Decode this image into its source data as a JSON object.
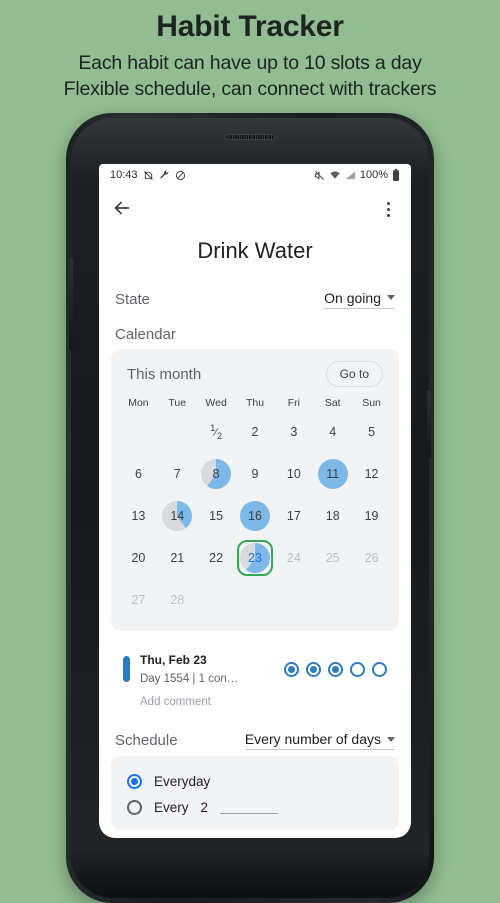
{
  "promo": {
    "title": "Habit Tracker",
    "subtitle_line1": "Each habit can have up to 10 slots a day",
    "subtitle_line2": "Flexible schedule, can connect with trackers"
  },
  "colors": {
    "background_green": "#92bd92",
    "accent_blue": "#7cb9e8",
    "slot_blue": "#2e7bbe",
    "radio_blue": "#1a73e8",
    "selected_ring_green": "#34a853",
    "card_grey": "#f1f3f4",
    "empty_day_grey": "#d8dadd"
  },
  "status_bar": {
    "time": "10:43",
    "left_icons": [
      "no-sim-icon",
      "wrench-icon",
      "do-not-disturb-icon"
    ],
    "right_icons": [
      "mute-icon",
      "wifi-icon",
      "signal-icon"
    ],
    "battery": "100%",
    "battery_icon": "battery-full-icon"
  },
  "app_bar": {
    "back_icon": "back-arrow-icon",
    "overflow_icon": "more-vertical-icon"
  },
  "habit": {
    "title": "Drink Water"
  },
  "state_row": {
    "label": "State",
    "value": "On going",
    "caret_icon": "chevron-down-icon"
  },
  "calendar": {
    "section_label": "Calendar",
    "month_label": "This month",
    "goto_label": "Go to",
    "weekdays": [
      "Mon",
      "Tue",
      "Wed",
      "Thu",
      "Fri",
      "Sat",
      "Sun"
    ],
    "weeks": [
      [
        {
          "label": "",
          "blank": true
        },
        {
          "label": "",
          "blank": true
        },
        {
          "label": "1/2",
          "fraction": true,
          "numerator": "1",
          "denominator": "2",
          "fill": 0,
          "dim": false
        },
        {
          "label": "2",
          "fill": 0,
          "dim": false
        },
        {
          "label": "3",
          "fill": 0,
          "dim": false
        },
        {
          "label": "4",
          "fill": 0,
          "dim": false
        },
        {
          "label": "5",
          "fill": 0,
          "dim": false
        }
      ],
      [
        {
          "label": "6",
          "fill": 0,
          "dim": false
        },
        {
          "label": "7",
          "fill": 0,
          "dim": false
        },
        {
          "label": "8",
          "fill": 60,
          "dim": false
        },
        {
          "label": "9",
          "fill": 0,
          "dim": false
        },
        {
          "label": "10",
          "fill": 0,
          "dim": false
        },
        {
          "label": "11",
          "fill": 100,
          "dim": false
        },
        {
          "label": "12",
          "fill": 0,
          "dim": false
        }
      ],
      [
        {
          "label": "13",
          "fill": 0,
          "dim": false
        },
        {
          "label": "14",
          "fill": 40,
          "dim": false
        },
        {
          "label": "15",
          "fill": 0,
          "dim": false
        },
        {
          "label": "16",
          "fill": 100,
          "dim": false
        },
        {
          "label": "17",
          "fill": 0,
          "dim": false
        },
        {
          "label": "18",
          "fill": 0,
          "dim": false
        },
        {
          "label": "19",
          "fill": 0,
          "dim": false
        }
      ],
      [
        {
          "label": "20",
          "fill": 0,
          "dim": false
        },
        {
          "label": "21",
          "fill": 0,
          "dim": false
        },
        {
          "label": "22",
          "fill": 0,
          "dim": false
        },
        {
          "label": "23",
          "fill": 60,
          "dim": false,
          "selected": true
        },
        {
          "label": "24",
          "fill": 0,
          "dim": true
        },
        {
          "label": "25",
          "fill": 0,
          "dim": true
        },
        {
          "label": "26",
          "fill": 0,
          "dim": true
        }
      ],
      [
        {
          "label": "27",
          "fill": 0,
          "dim": true
        },
        {
          "label": "28",
          "fill": 0,
          "dim": true
        },
        {
          "label": "",
          "blank": true
        },
        {
          "label": "",
          "blank": true
        },
        {
          "label": "",
          "blank": true
        },
        {
          "label": "",
          "blank": true
        },
        {
          "label": "",
          "blank": true
        }
      ]
    ]
  },
  "entry": {
    "date": "Thu, Feb 23",
    "meta": "Day 1554 | 1 con…",
    "slots": [
      true,
      true,
      true,
      false,
      false
    ],
    "add_comment_placeholder": "Add comment"
  },
  "schedule": {
    "section_label": "Schedule",
    "mode_value": "Every number of days",
    "caret_icon": "chevron-down-icon",
    "options": [
      {
        "label": "Everyday",
        "selected": true
      },
      {
        "label": "Every",
        "selected": false,
        "value": "2"
      }
    ]
  }
}
